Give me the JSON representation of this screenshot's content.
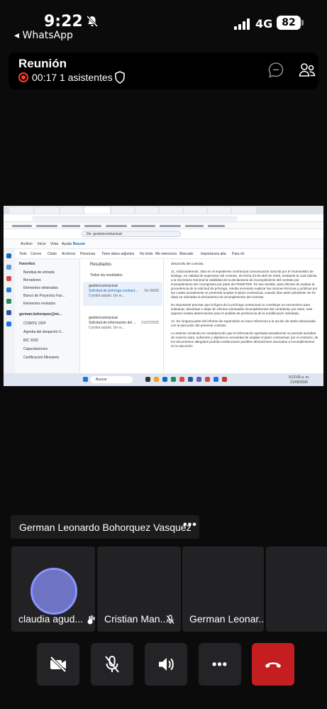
{
  "status_bar": {
    "time": "9:22",
    "back_app": "◂ WhatsApp",
    "network": "4G",
    "battery": "82"
  },
  "meeting": {
    "title": "Reunión",
    "duration": "00:17",
    "attendees": "1 asistentes"
  },
  "shared_screen": {
    "search_text": "De: gestioncontractual",
    "menu": [
      "Archivo",
      "Inicio",
      "Vista",
      "Ayuda",
      "Buscar"
    ],
    "filters": [
      "Todo",
      "Correo",
      "Chats",
      "Archivos",
      "Personas",
      "Tiene datos adjuntos",
      "No leído",
      "Me menciona",
      "Marcado",
      "Importancia alta",
      "Para mí"
    ],
    "folders": [
      "Favoritos",
      "Bandeja de entrada",
      "Borradores",
      "Elementos eliminados",
      "Banco de Proyectos Fas...",
      "Elementos enviados",
      "german.bohorquez@mi...",
      "COMITE ODP",
      "Agenda del despacho V...",
      "BIC 2026",
      "Capacitaciones",
      "Certificacion Ministerio"
    ],
    "results_header": "Resultados",
    "results_group": "Todos los resultados",
    "result_items": [
      {
        "sender": "gestioncontractual",
        "subject": "Solicitud de prórroga contract...",
        "preview": "Cordial saludo. De m...",
        "date": "Vie 08/09"
      },
      {
        "sender": "gestioncontractual",
        "subject": "Solicitud de información del ...",
        "preview": "Cordial saludo. De m...",
        "date": "21/07/2025"
      }
    ],
    "reading_paragraphs": [
      "desarrollo del contrato.",
      "11. Adicionalmente, obra en el expediente contractual comunicación suscrita por el Viceministro de Diálogo, en calidad de supervisor del contrato, de fecha 23 de abril de 2026, mediante la cual solicita a la Secretaría General la viabilidad de la declaratoria de incumplimiento del contrato por incumplimiento del cronograma por parte de FINDETER. En ese sentido, para efectos de evaluar la procedencia de la solicitud de prórroga, resulta necesario explicar las razones técnicas y jurídicas por las cuales actualmente se pretende ampliar el plazo contractual, cuando días atrás (alrededor de 20 días) se solicitaba la declaratoria de incumplimiento del contrato.",
      "Es importante precisar que la figura de la prórroga contractual no constituye un mecanismo para subsanar, desvirtuar o dejar sin efectos eventuales incumplimientos del contratista; por tanto, este aspecto resulta determinante para el análisis de pertinencia de la modificación solicitada.",
      "12. En ninguna parte del informe de supervisión se hace referencia a la acción de tutela relacionada con la ejecución del presente contrato.",
      "Lo anterior, teniendo en consideración que la información aportada actualmente no permite acreditar de manera clara, suficiente y objetiva la necesidad de ampliar el plazo contractual; por el contrario, de los documentos allegados podrían evidenciarse posibles afectaciones asociadas a incumplimientos en la ejecución"
    ],
    "taskbar_search": "Buscar",
    "taskbar_time": "9:22:09 a. m.",
    "taskbar_date": "21/05/2026"
  },
  "active_speaker": {
    "name": "German Leonardo Bohorquez Vasquez",
    "more": "•••"
  },
  "participants": [
    {
      "name": "claudia agud...",
      "status_icon": "hand-raise-icon"
    },
    {
      "name": "Cristian Man...",
      "status_icon": "mic-off-icon"
    },
    {
      "name": "German Leonar...",
      "status_icon": ""
    }
  ],
  "controls": {
    "more": "•••",
    "colors": {
      "end_call": "#c41e20",
      "record": "#ff3b30",
      "avatar_ring": "#8c93ff"
    }
  }
}
